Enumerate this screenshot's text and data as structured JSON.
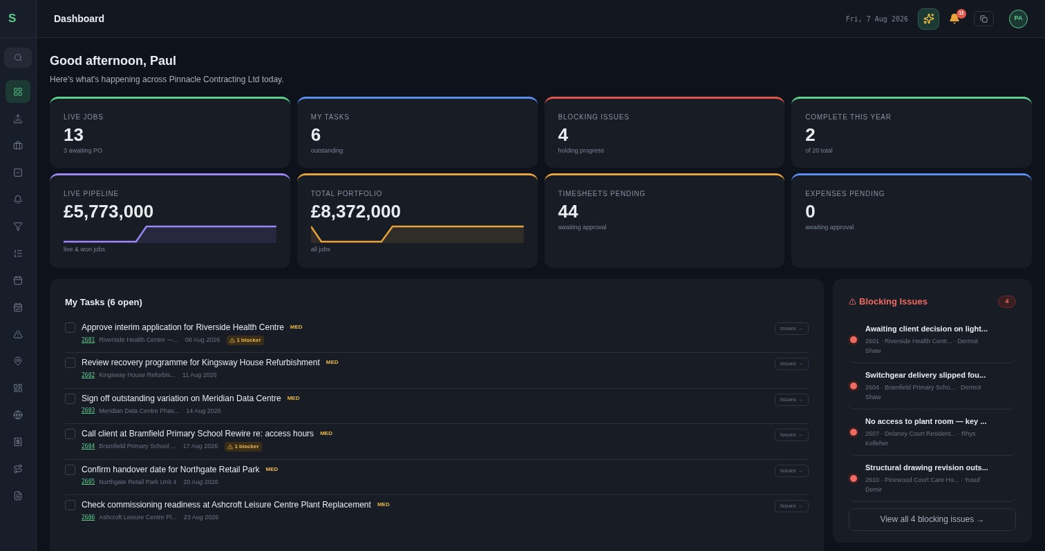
{
  "sidebar": {
    "logo": "S",
    "items": [
      {
        "kind": "search",
        "selected": false
      },
      {
        "kind": "grid",
        "selected": true
      },
      {
        "kind": "sunrise",
        "selected": false
      },
      {
        "kind": "briefcase",
        "selected": false
      },
      {
        "kind": "task",
        "selected": false
      },
      {
        "kind": "bell",
        "selected": false
      },
      {
        "kind": "filter",
        "selected": false
      },
      {
        "kind": "list",
        "selected": false
      },
      {
        "kind": "calendar",
        "selected": false
      },
      {
        "kind": "calendar-range",
        "selected": false
      },
      {
        "kind": "warning",
        "selected": false
      },
      {
        "kind": "pin",
        "selected": false
      },
      {
        "kind": "apps",
        "selected": false
      },
      {
        "kind": "globe",
        "selected": false
      },
      {
        "kind": "receipt",
        "selected": false
      },
      {
        "kind": "route",
        "selected": false
      },
      {
        "kind": "file",
        "selected": false
      }
    ]
  },
  "header": {
    "title": "Dashboard",
    "date": "Fri, 7 Aug 2026",
    "notifications": "11",
    "avatar": "PA"
  },
  "greeting": {
    "title": "Good afternoon, Paul",
    "subtitle": "Here's what's happening across Pinnacle Contracting Ltd today."
  },
  "stats": [
    {
      "label": "LIVE JOBS",
      "value": "13",
      "note": "3 awaiting PO",
      "color": "#5fcf8f",
      "kind": "plain"
    },
    {
      "label": "MY TASKS",
      "value": "6",
      "note": "outstanding",
      "color": "#5b8def",
      "kind": "plain"
    },
    {
      "label": "BLOCKING ISSUES",
      "value": "4",
      "note": "holding progress",
      "color": "#e0584c",
      "kind": "plain"
    },
    {
      "label": "COMPLETE THIS YEAR",
      "value": "2",
      "note": "of 20 total",
      "color": "#5fcf8f",
      "kind": "plain"
    },
    {
      "label": "LIVE PIPELINE",
      "value": "£5,773,000",
      "note": "live & won jobs",
      "color": "#9b87f5",
      "kind": "rise"
    },
    {
      "label": "TOTAL PORTFOLIO",
      "value": "£8,372,000",
      "note": "all jobs",
      "color": "#e8a33d",
      "kind": "dip"
    },
    {
      "label": "TIMESHEETS PENDING",
      "value": "44",
      "note": "awaiting approval",
      "color": "#e8a33d",
      "kind": "plain"
    },
    {
      "label": "EXPENSES PENDING",
      "value": "0",
      "note": "awaiting approval",
      "color": "#5b8def",
      "kind": "plain"
    }
  ],
  "tasks": {
    "title": "My Tasks (6 open)",
    "items": [
      {
        "title": "Approve interim application for Riverside Health Centre",
        "priority": "MED",
        "job": "2601",
        "project": "Riverside Health Centre —...",
        "date": "08 Aug 2026",
        "blocker": "1 blocker",
        "checked": false,
        "action": "Issues →"
      },
      {
        "title": "Review recovery programme for Kingsway House Refurbishment",
        "priority": "MED",
        "job": "2602",
        "project": "Kingsway House Refurbis...",
        "date": "11 Aug 2026",
        "checked": false,
        "action": "Issues →"
      },
      {
        "title": "Sign off outstanding variation on Meridian Data Centre",
        "priority": "MED",
        "job": "2603",
        "project": "Meridian Data Centre Phas...",
        "date": "14 Aug 2026",
        "checked": false,
        "action": "Issues →"
      },
      {
        "title": "Call client at Bramfield Primary School Rewire re: access hours",
        "priority": "MED",
        "job": "2604",
        "project": "Bramfield Primary School ...",
        "date": "17 Aug 2026",
        "blocker": "1 blocker",
        "checked": false,
        "action": "Issues →"
      },
      {
        "title": "Confirm handover date for Northgate Retail Park",
        "priority": "MED",
        "job": "2605",
        "project": "Northgate Retail Park Unit 4",
        "date": "20 Aug 2026",
        "checked": false,
        "action": "Issues →"
      },
      {
        "title": "Check commissioning readiness at Ashcroft Leisure Centre Plant Replacement",
        "priority": "MED",
        "job": "2606",
        "project": "Ashcroft Leisure Centre Pl...",
        "date": "23 Aug 2026",
        "checked": false,
        "action": "Issues →"
      }
    ]
  },
  "blocking": {
    "title": "Blocking Issues",
    "count": "4",
    "items": [
      {
        "title": "Awaiting client decision on light...",
        "meta": "2601 · Riverside Health Centr... · Dermot Shaw",
        "color": "#ef6b61"
      },
      {
        "title": "Switchgear delivery slipped fou...",
        "meta": "2604 · Bramfield Primary Scho... · Dermot Shaw",
        "color": "#ef6b61"
      },
      {
        "title": "No access to plant room — key ...",
        "meta": "2607 · Delaney Court Resident... · Rhys Kelleher",
        "color": "#ef6b61"
      },
      {
        "title": "Structural drawing revision outs...",
        "meta": "2610 · Pinewood Court Care Ho... · Yusuf Demir",
        "color": "#ef6b61"
      }
    ],
    "button": "View all 4 blocking issues →"
  }
}
